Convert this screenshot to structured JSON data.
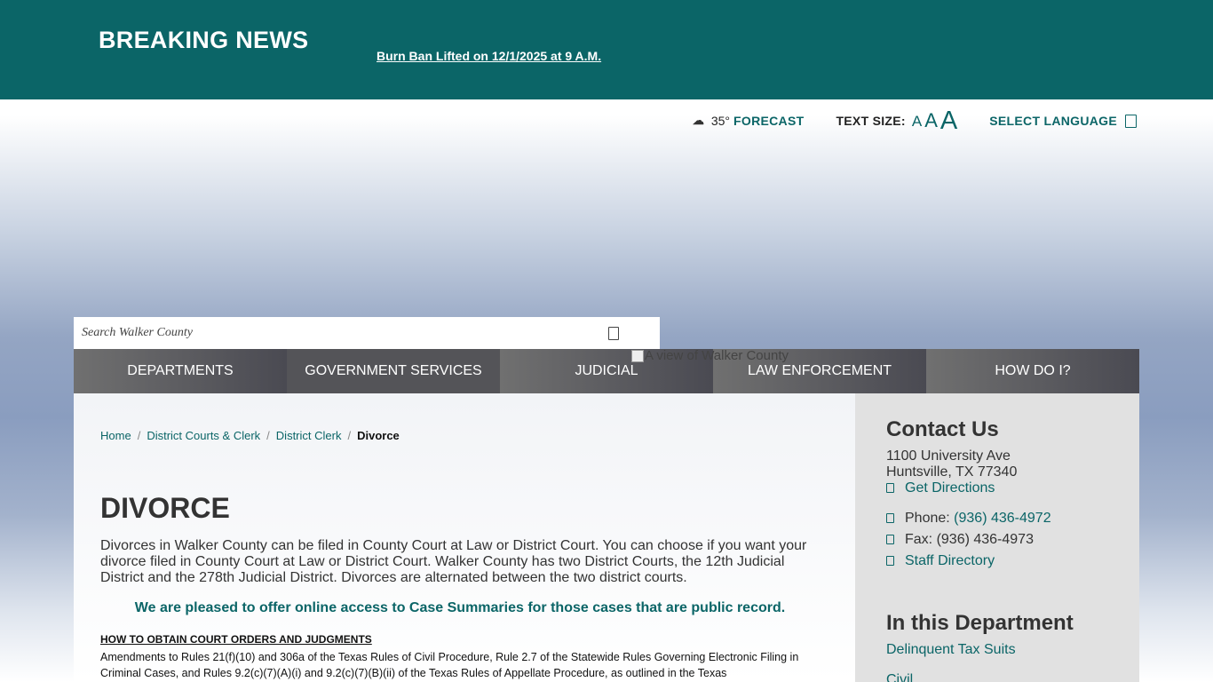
{
  "breaking": {
    "title": "BREAKING NEWS",
    "link": "Burn Ban Lifted on 12/1/2025 at 9 A.M."
  },
  "utility": {
    "temperature": "35°",
    "forecast": "FORECAST",
    "text_size_label": "TEXT SIZE:",
    "text_size_small": "A",
    "text_size_medium": "A",
    "text_size_large": "A",
    "language": "SELECT LANGUAGE"
  },
  "search": {
    "placeholder": "Search Walker County"
  },
  "hero_image_alt": "A view of Walker County",
  "nav": {
    "items": [
      {
        "label": "DEPARTMENTS"
      },
      {
        "label": "GOVERNMENT SERVICES"
      },
      {
        "label": "JUDICIAL"
      },
      {
        "label": "LAW ENFORCEMENT"
      },
      {
        "label": "HOW DO I?"
      }
    ]
  },
  "breadcrumb": {
    "home": "Home",
    "level1": "District Courts & Clerk",
    "level2": "District Clerk",
    "current": "Divorce",
    "separator": "/"
  },
  "main": {
    "title": "DIVORCE",
    "intro": "Divorces in Walker County can be filed in County Court at Law or District Court. You can choose if you want your divorce filed in County Court at Law or District Court. Walker County has two District Courts, the 12th Judicial District and the 278th Judicial District. Divorces are alternated between the two district courts.",
    "highlight": "We are pleased to offer online access to Case Summaries for those cases that are public record.",
    "subhead": "HOW TO OBTAIN COURT ORDERS AND JUDGMENTS",
    "body": "Amendments to Rules 21(f)(10) and 306a of the Texas Rules of Civil Procedure, Rule 2.7 of the Statewide Rules Governing Electronic Filing in Criminal Cases, and Rules 9.2(c)(7)(A)(i) and 9.2(c)(7)(B)(ii) of the Texas Rules of Appellate Procedure, as outlined in the Texas"
  },
  "sidebar": {
    "contact_heading": "Contact Us",
    "address1": "1100 University Ave",
    "address2": "Huntsville, TX 77340",
    "directions": "Get Directions",
    "phone_label": "Phone:",
    "phone": "(936) 436-4972",
    "fax": "Fax: (936) 436-4973",
    "staff": "Staff Directory",
    "dept_heading": "In this Department",
    "dept_link1": "Delinquent Tax Suits",
    "dept_link2": "Civil"
  },
  "colors": {
    "brand": "#0b6567",
    "nav": "#545458",
    "sidebar": "#e1e1e1"
  }
}
